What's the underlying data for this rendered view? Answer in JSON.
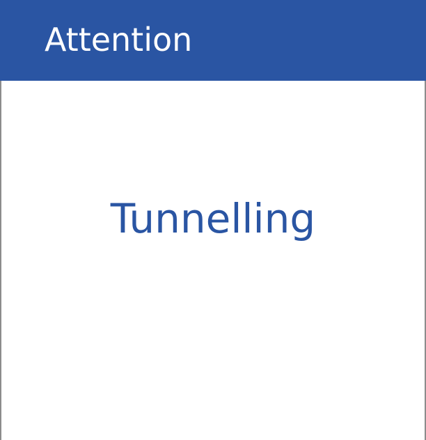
{
  "header": {
    "title": "Attention"
  },
  "main": {
    "message": "Tunnelling"
  },
  "colors": {
    "header_background": "#2a55a3",
    "header_text": "#ffffff",
    "message_text": "#2a55a3",
    "panel_background": "#ffffff",
    "border": "#8c8c8c"
  }
}
